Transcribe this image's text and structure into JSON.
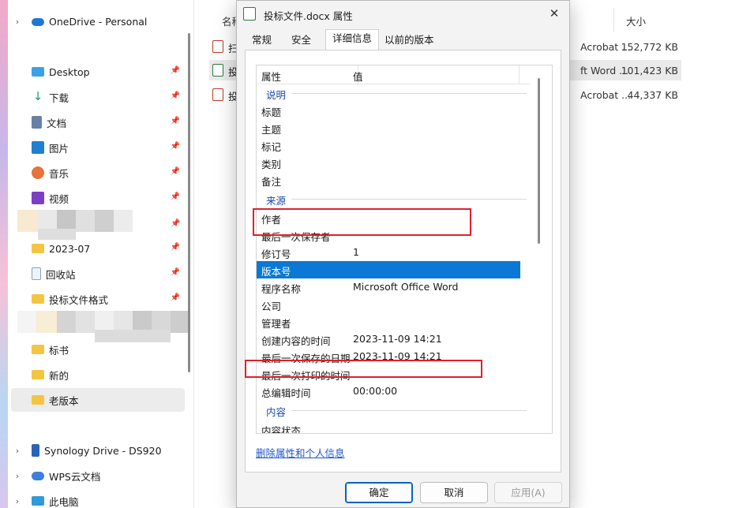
{
  "sidebar": {
    "items": [
      {
        "label": "OneDrive - Personal",
        "icon": "cloud-icon",
        "has_chevron": true,
        "pinned": false
      },
      {
        "label": "Desktop",
        "icon": "desktop-icon",
        "pinned": true
      },
      {
        "label": "下载",
        "icon": "download-icon",
        "pinned": true
      },
      {
        "label": "文档",
        "icon": "document-icon",
        "pinned": true
      },
      {
        "label": "图片",
        "icon": "picture-icon",
        "pinned": true
      },
      {
        "label": "音乐",
        "icon": "music-icon",
        "pinned": true
      },
      {
        "label": "视频",
        "icon": "video-icon",
        "pinned": true
      },
      {
        "label": "2023-07",
        "icon": "folder-icon",
        "pinned": true
      },
      {
        "label": "回收站",
        "icon": "recycle-bin-icon",
        "pinned": true
      },
      {
        "label": "投标文件格式",
        "icon": "folder-icon",
        "pinned": true
      },
      {
        "label": "标书",
        "icon": "folder-icon",
        "pinned": false
      },
      {
        "label": "新的",
        "icon": "folder-icon",
        "pinned": false
      },
      {
        "label": "老版本",
        "icon": "folder-icon",
        "pinned": false,
        "selected": true
      },
      {
        "label": "Synology Drive - DS920",
        "icon": "synology-drive-icon",
        "has_chevron": true
      },
      {
        "label": "WPS云文档",
        "icon": "wps-cloud-icon",
        "has_chevron": true
      },
      {
        "label": "此电脑",
        "icon": "computer-icon",
        "has_chevron": true
      }
    ]
  },
  "explorer": {
    "columns": {
      "name": "名称",
      "size": "大小"
    },
    "files": [
      {
        "name": "扫",
        "type": "Acrobat ...",
        "size": "152,772 KB",
        "icon": "pdf-file-icon"
      },
      {
        "name": "投",
        "type": "ft Word ...",
        "size": "101,423 KB",
        "icon": "word-file-icon",
        "selected": true
      },
      {
        "name": "投",
        "type": "Acrobat ...",
        "size": "44,337 KB",
        "icon": "pdf-file-icon"
      }
    ]
  },
  "dialog": {
    "title": "投标文件.docx 属性",
    "close_glyph": "✕",
    "tabs": [
      "常规",
      "安全",
      "详细信息",
      "以前的版本"
    ],
    "active_tab": "详细信息",
    "list_header": {
      "property": "属性",
      "value": "值"
    },
    "groups": {
      "description": "说明",
      "origin": "来源",
      "content": "内容"
    },
    "rows": [
      {
        "name": "标题",
        "value": ""
      },
      {
        "name": "主题",
        "value": ""
      },
      {
        "name": "标记",
        "value": ""
      },
      {
        "name": "类别",
        "value": ""
      },
      {
        "name": "备注",
        "value": ""
      },
      {
        "name": "作者",
        "value": ""
      },
      {
        "name": "最后一次保存者",
        "value": ""
      },
      {
        "name": "修订号",
        "value": "1"
      },
      {
        "name": "版本号",
        "value": "",
        "selected": true
      },
      {
        "name": "程序名称",
        "value": "Microsoft Office Word"
      },
      {
        "name": "公司",
        "value": ""
      },
      {
        "name": "管理者",
        "value": ""
      },
      {
        "name": "创建内容的时间",
        "value": "2023-11-09 14:21"
      },
      {
        "name": "最后一次保存的日期",
        "value": "2023-11-09 14:21"
      },
      {
        "name": "最后一次打印的时间",
        "value": ""
      },
      {
        "name": "总编辑时间",
        "value": "00:00:00"
      },
      {
        "name": "内容状态",
        "value": ""
      }
    ],
    "remove_link": "删除属性和个人信息",
    "buttons": {
      "ok": "确定",
      "cancel": "取消",
      "apply": "应用(A)"
    }
  },
  "colors": {
    "selection": "#0a78d4",
    "annotation": "#e0202a",
    "link": "#1f55c9"
  }
}
